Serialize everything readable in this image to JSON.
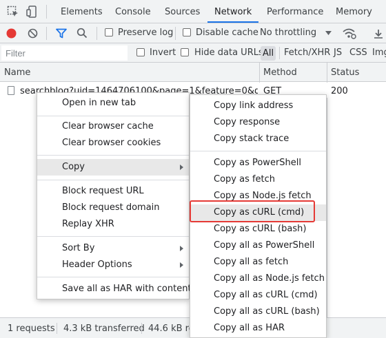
{
  "tabbar": {
    "tabs": [
      "Elements",
      "Console",
      "Sources",
      "Network",
      "Performance",
      "Memory"
    ],
    "active_tab": "Network"
  },
  "toolbar": {
    "preserve_log": "Preserve log",
    "disable_cache": "Disable cache",
    "throttling": "No throttling"
  },
  "filterbar": {
    "placeholder": "Filter",
    "invert": "Invert",
    "hide_data_urls": "Hide data URLs",
    "types": [
      "All",
      "Fetch/XHR",
      "JS",
      "CSS",
      "Img"
    ]
  },
  "table": {
    "columns": [
      "Name",
      "Method",
      "Status"
    ],
    "rows": [
      {
        "name": "searchblog?uid=1464706100&page=1&feature=0&q=%...",
        "method": "GET",
        "status": "200"
      }
    ]
  },
  "statusbar": {
    "requests": "1 requests",
    "transferred": "4.3 kB transferred",
    "resources": "44.6 kB re"
  },
  "context_menu": {
    "items": [
      "Open in new tab",
      "Clear browser cache",
      "Clear browser cookies",
      "Copy",
      "Block request URL",
      "Block request domain",
      "Replay XHR",
      "Sort By",
      "Header Options",
      "Save all as HAR with content"
    ]
  },
  "copy_submenu": {
    "items": [
      "Copy link address",
      "Copy response",
      "Copy stack trace",
      "Copy as PowerShell",
      "Copy as fetch",
      "Copy as Node.js fetch",
      "Copy as cURL (cmd)",
      "Copy as cURL (bash)",
      "Copy all as PowerShell",
      "Copy all as fetch",
      "Copy all as Node.js fetch",
      "Copy all as cURL (cmd)",
      "Copy all as cURL (bash)",
      "Copy all as HAR"
    ]
  },
  "colors": {
    "accent": "#1a73e8",
    "record": "#e53935",
    "highlight_box": "#e53935"
  },
  "icons": [
    "inspect-element-icon",
    "device-toolbar-icon",
    "record-icon",
    "clear-icon",
    "filter-icon",
    "search-icon",
    "throttle-dropdown-icon",
    "network-conditions-icon",
    "file-icon",
    "submenu-arrow-icon"
  ]
}
